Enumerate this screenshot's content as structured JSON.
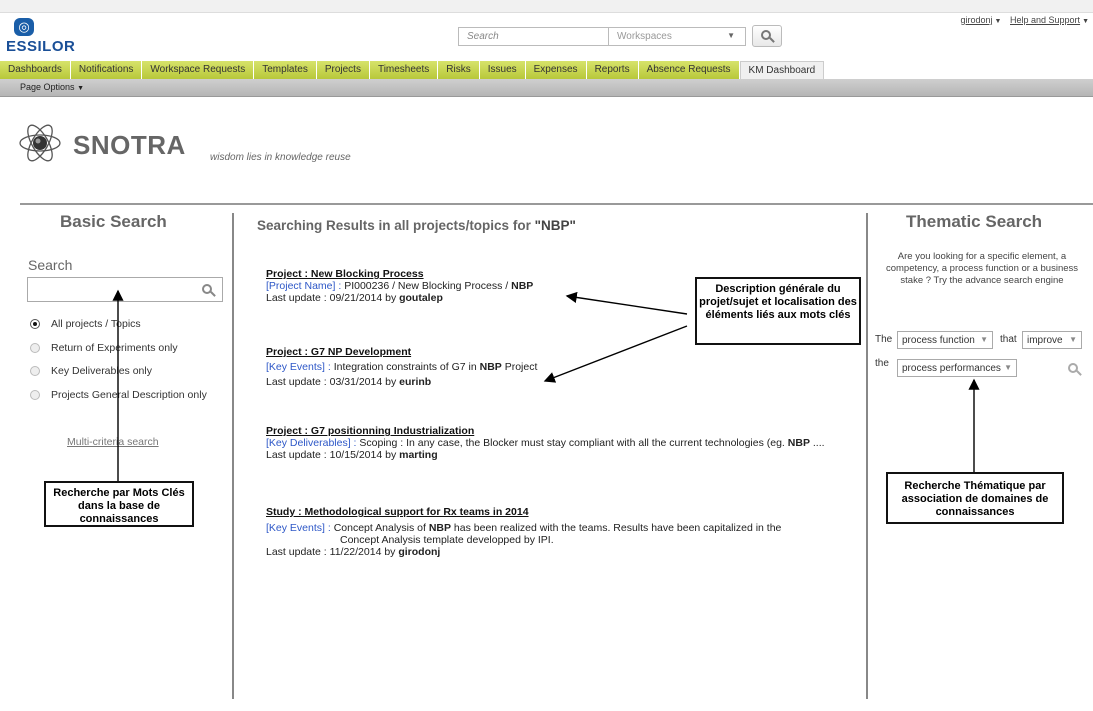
{
  "header": {
    "logo_text": "ESSILOR",
    "search_placeholder": "Search",
    "workspace_select": "Workspaces",
    "user": "girodonj",
    "help": "Help and Support"
  },
  "nav": {
    "tabs": [
      "Dashboards",
      "Notifications",
      "Workspace Requests",
      "Templates",
      "Projects",
      "Timesheets",
      "Risks",
      "Issues",
      "Expenses",
      "Reports",
      "Absence Requests",
      "KM Dashboard"
    ],
    "active_tab": "KM Dashboard",
    "page_options": "Page Options"
  },
  "app": {
    "title": "SNOTRA",
    "tagline": "wisdom lies in knowledge reuse"
  },
  "basic_search": {
    "title": "Basic Search",
    "search_label": "Search",
    "input_value": "",
    "options": [
      "All projects / Topics",
      "Return of Experiments only",
      "Key Deliverables only",
      "Projects General Description only"
    ],
    "selected_option": "All projects / Topics",
    "multi_criteria_link": "Multi-criteria search"
  },
  "results": {
    "title_prefix": "Searching Results in all projects/topics for ",
    "query": "\"NBP\"",
    "items": [
      {
        "project": "Project : New Blocking Process",
        "tag": "[Project Name] :",
        "text_before": " PI000236 / New Blocking Process / ",
        "keyword": "NBP",
        "text_after": "",
        "text_line2": "",
        "update_prefix": "Last update : 09/21/2014 by ",
        "user": "goutalep"
      },
      {
        "project": "Project : G7 NP Development",
        "tag": "[Key Events] :",
        "text_before": "  Integration constraints of G7 in ",
        "keyword": "NBP",
        "text_after": " Project",
        "text_line2": "",
        "update_prefix": "Last update : 03/31/2014 by ",
        "user": "eurinb"
      },
      {
        "project": "Project : G7 positionning Industrialization",
        "tag": "[Key Deliverables] :",
        "text_before": " Scoping : In any case, the Blocker must stay compliant with all the current technologies (eg. ",
        "keyword": "NBP",
        "text_after": " ....",
        "text_line2": "",
        "update_prefix": "Last update : 10/15/2014 by ",
        "user": "marting"
      },
      {
        "project": "Study : Methodological support for Rx teams in 2014",
        "tag": "[Key Events] :",
        "text_before": "  Concept Analysis of ",
        "keyword": "NBP",
        "text_after": " has been realized with the teams. Results have been capitalized in the",
        "text_line2": "Concept Analysis template developped by IPI.",
        "update_prefix": "Last update : 11/22/2014 by  ",
        "user": "girodonj"
      }
    ]
  },
  "thematic_search": {
    "title": "Thematic Search",
    "description": "Are you looking for a specific element, a competency, a process function or a business stake ? Try the advance search engine",
    "word_the": "The",
    "word_that": "that",
    "word_the2": "the",
    "select_subject": "process function",
    "select_verb": "improve",
    "select_object": "process performances"
  },
  "annotations": {
    "callout_results": "Description générale du projet/sujet et localisation des éléments liés aux mots clés",
    "callout_basic": "Recherche par Mots Clés dans la base de connaissances",
    "callout_thematic": "Recherche Thématique par association de domaines de connaissances"
  }
}
